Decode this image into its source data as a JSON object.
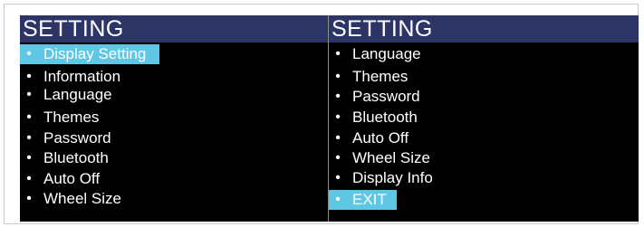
{
  "colors": {
    "header_bg": "#2d3566",
    "panel_bg": "#000000",
    "selected_bg": "#5ec8e4",
    "text": "#ffffff"
  },
  "left": {
    "title": "SETTING",
    "items": [
      {
        "label": "Display Setting",
        "selected": true
      },
      {
        "label": "Information",
        "selected": false
      },
      {
        "label": "Language",
        "selected": false
      },
      {
        "label": "Themes",
        "selected": false
      },
      {
        "label": "Password",
        "selected": false
      },
      {
        "label": "Bluetooth",
        "selected": false
      },
      {
        "label": "Auto Off",
        "selected": false
      },
      {
        "label": "Wheel Size",
        "selected": false
      }
    ]
  },
  "right": {
    "title": "SETTING",
    "items": [
      {
        "label": "Language",
        "selected": false
      },
      {
        "label": "Themes",
        "selected": false
      },
      {
        "label": "Password",
        "selected": false
      },
      {
        "label": "Bluetooth",
        "selected": false
      },
      {
        "label": "Auto Off",
        "selected": false
      },
      {
        "label": "Wheel Size",
        "selected": false
      },
      {
        "label": "Display Info",
        "selected": false
      },
      {
        "label": "EXIT",
        "selected": true
      }
    ]
  },
  "bullet_glyph": "•"
}
